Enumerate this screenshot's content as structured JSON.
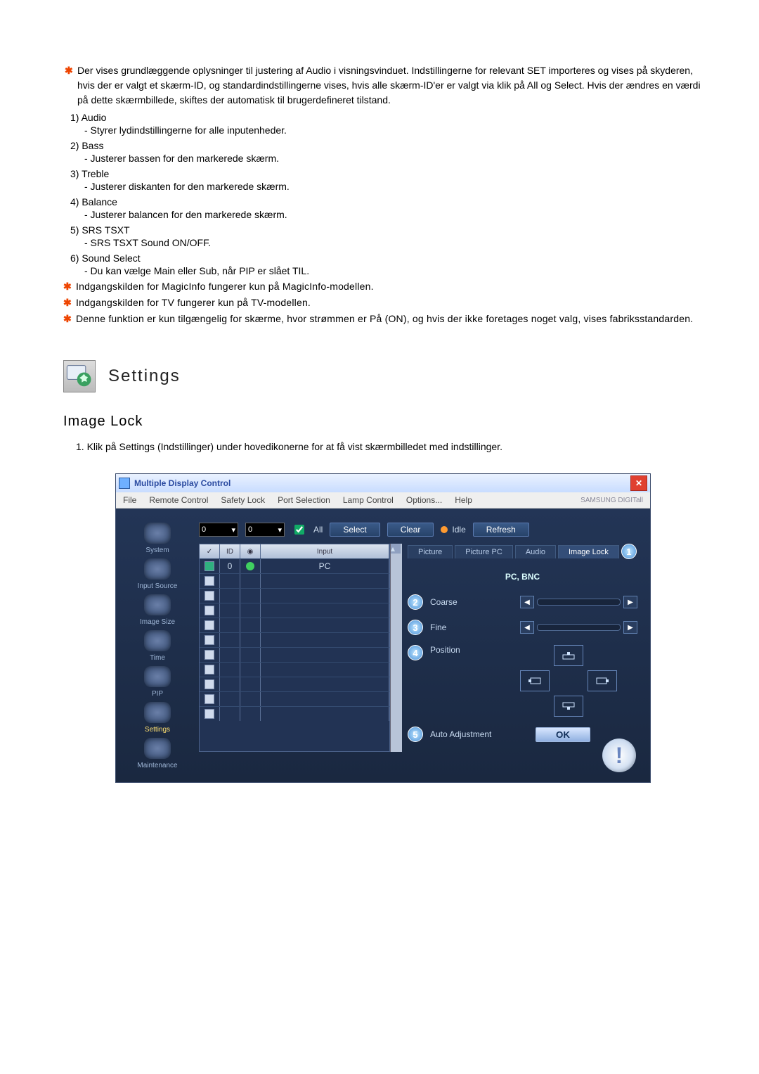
{
  "intro_star": "Der vises grundlæggende oplysninger til justering af Audio i visningsvinduet. Indstillingerne for relevant SET importeres og vises på skyderen, hvis der er valgt et skærm-ID, og standardindstillingerne vises, hvis alle skærm-ID'er er valgt via klik på All og Select. Hvis der ændres en værdi på dette skærmbillede, skiftes der automatisk til brugerdefineret tilstand.",
  "numbered": [
    {
      "num": "1)",
      "title": "Audio",
      "desc": "- Styrer lydindstillingerne for alle inputenheder."
    },
    {
      "num": "2)",
      "title": "Bass",
      "desc": "- Justerer bassen for den markerede skærm."
    },
    {
      "num": "3)",
      "title": "Treble",
      "desc": "- Justerer diskanten for den markerede skærm."
    },
    {
      "num": "4)",
      "title": "Balance",
      "desc": "- Justerer balancen for den markerede skærm."
    },
    {
      "num": "5)",
      "title": "SRS TSXT",
      "desc": "- SRS TSXT Sound ON/OFF."
    },
    {
      "num": "6)",
      "title": "Sound Select",
      "desc": "- Du kan vælge Main eller Sub, når PIP er slået TIL."
    }
  ],
  "notes": [
    "Indgangskilden for MagicInfo fungerer kun på MagicInfo-modellen.",
    "Indgangskilden for TV fungerer kun på TV-modellen.",
    "Denne funktion er kun tilgængelig for skærme, hvor strømmen er På (ON), og hvis der ikke foretages noget valg, vises fabriksstandarden."
  ],
  "settings_heading": "Settings",
  "section_title": "Image Lock",
  "step": "1. Klik på Settings (Indstillinger) under hovedikonerne for at få vist skærmbilledet med indstillinger.",
  "win": {
    "title": "Multiple Display Control",
    "menu": [
      "File",
      "Remote Control",
      "Safety Lock",
      "Port Selection",
      "Lamp Control",
      "Options...",
      "Help"
    ],
    "brand": "SAMSUNG DIGITall",
    "dd1": "0",
    "dd2": "0",
    "all": "All",
    "select": "Select",
    "clear": "Clear",
    "idle": "Idle",
    "refresh": "Refresh",
    "sidebar": [
      "System",
      "Input Source",
      "Image Size",
      "Time",
      "PIP",
      "Settings",
      "Maintenance"
    ],
    "grid_head": {
      "c1": "",
      "c2": "ID",
      "c3": "",
      "c4": "Input"
    },
    "grid_row0": {
      "id": "0",
      "input": "PC"
    },
    "tabs": [
      "Picture",
      "Picture PC",
      "Audio",
      "Image Lock"
    ],
    "source": "PC, BNC",
    "controls": {
      "coarse": "Coarse",
      "fine": "Fine",
      "position": "Position",
      "auto": "Auto Adjustment"
    },
    "ok": "OK"
  },
  "icons": {
    "star": "star-icon",
    "close": "close-icon",
    "dropdown": "chevron-down-icon"
  }
}
